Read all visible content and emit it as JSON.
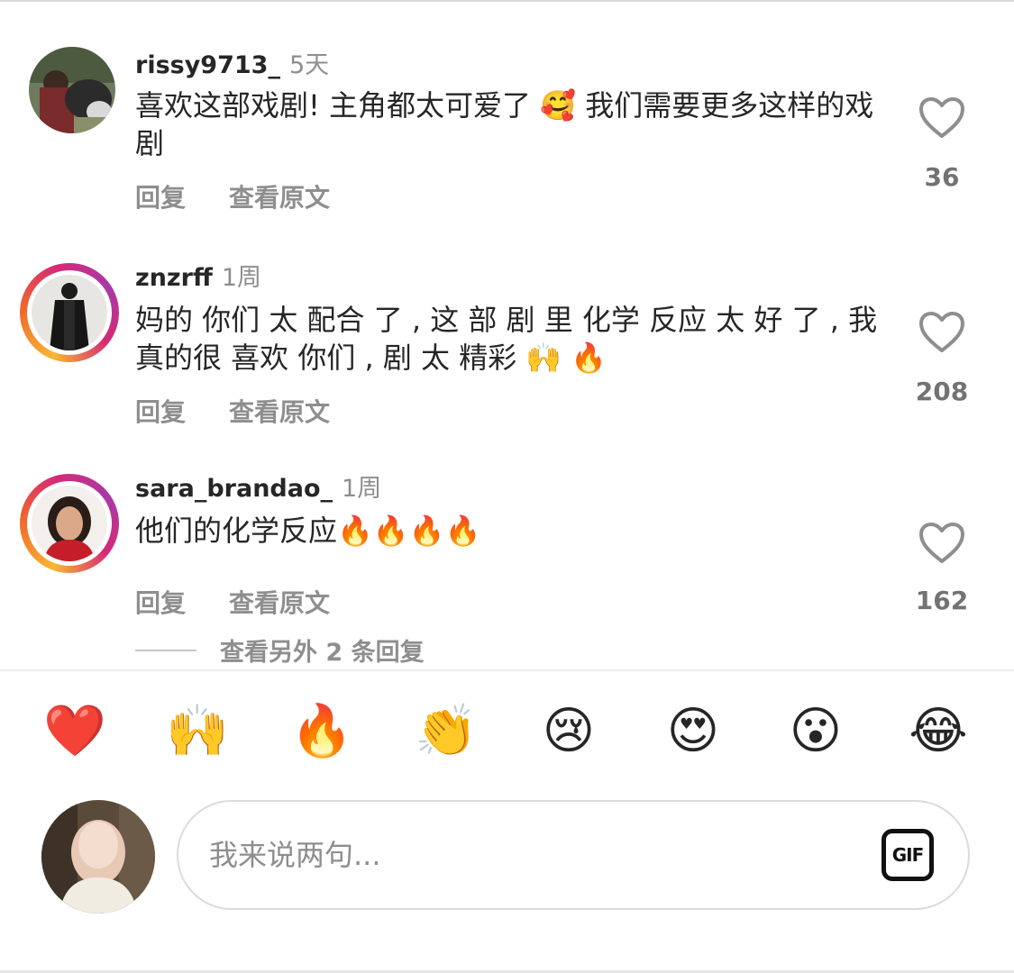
{
  "comments": [
    {
      "username": "rissy9713_",
      "time": "5天",
      "text": "喜欢这部戏剧! 主角都太可爱了 🥰 我们需要更多这样的戏剧",
      "reply_label": "回复",
      "view_original_label": "查看原文",
      "likes": "36"
    },
    {
      "username": "znzrff",
      "time": "1周",
      "text": "妈的 你们 太 配合 了 , 这 部 剧 里 化学 反应 太 好 了 , 我 真的很 喜欢 你们 , 剧 太 精彩 🙌 🔥",
      "reply_label": "回复",
      "view_original_label": "查看原文",
      "likes": "208"
    },
    {
      "username": "sara_brandao_",
      "time": "1周",
      "text": "他们的化学反应🔥🔥🔥🔥",
      "reply_label": "回复",
      "view_original_label": "查看原文",
      "likes": "162"
    }
  ],
  "view_more_replies": "查看另外 2 条回复",
  "emoji_bar": [
    "❤️",
    "🙌",
    "🔥",
    "👏",
    "😢",
    "😍",
    "😮",
    "😂"
  ],
  "composer": {
    "placeholder": "我来说两句...",
    "gif_label": "GIF"
  },
  "colors": {
    "text": "#262626",
    "secondary": "#8e8e8e",
    "story_ring_start": "#f7b733",
    "story_ring_end": "#d62976"
  }
}
